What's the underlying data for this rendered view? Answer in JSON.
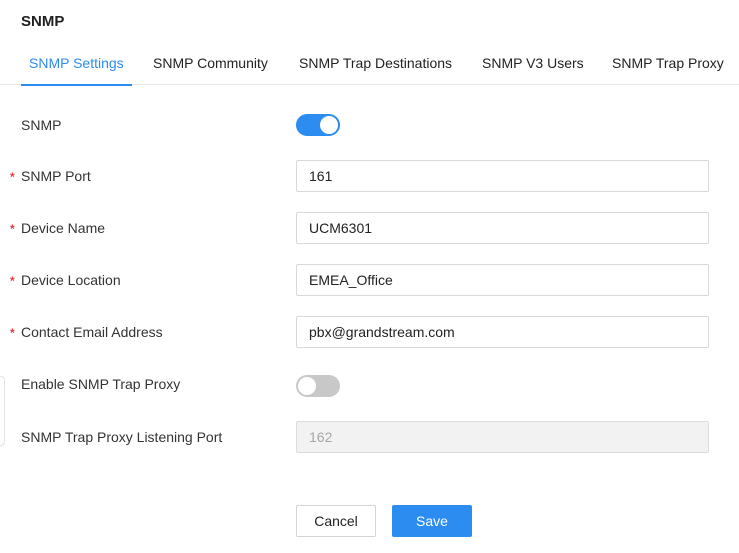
{
  "header": {
    "title": "SNMP"
  },
  "tabs": [
    {
      "label": "SNMP Settings",
      "active": true
    },
    {
      "label": "SNMP Community",
      "active": false
    },
    {
      "label": "SNMP Trap Destinations",
      "active": false
    },
    {
      "label": "SNMP V3 Users",
      "active": false
    },
    {
      "label": "SNMP Trap Proxy",
      "active": false
    }
  ],
  "form": {
    "snmp": {
      "label": "SNMP",
      "enabled": true
    },
    "port": {
      "label": "SNMP Port",
      "required": "*",
      "value": "161"
    },
    "device_name": {
      "label": "Device Name",
      "required": "*",
      "value": "UCM6301"
    },
    "device_location": {
      "label": "Device Location",
      "required": "*",
      "value": "EMEA_Office"
    },
    "contact_email": {
      "label": "Contact Email Address",
      "required": "*",
      "value": "pbx@grandstream.com"
    },
    "trap_proxy": {
      "label": "Enable SNMP Trap Proxy",
      "enabled": false
    },
    "trap_proxy_port": {
      "label": "SNMP Trap Proxy Listening Port",
      "value": "162",
      "disabled": true
    }
  },
  "actions": {
    "cancel_label": "Cancel",
    "save_label": "Save"
  },
  "colors": {
    "accent": "#2d8cf0",
    "required": "#e23c3c",
    "toggle_off": "#c8c8c8"
  }
}
